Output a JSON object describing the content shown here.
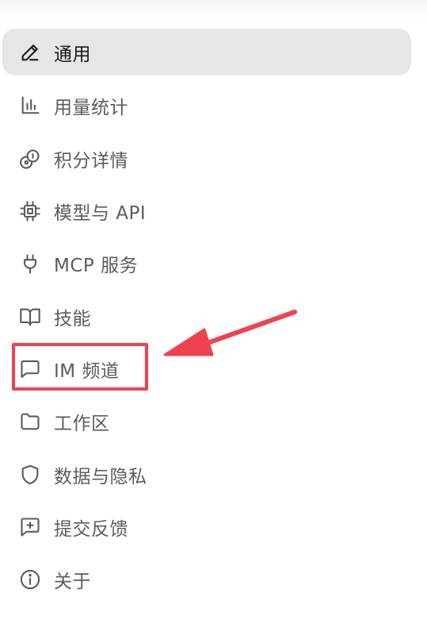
{
  "nav": {
    "items": [
      {
        "label": "通用",
        "icon": "pencil-icon",
        "active": true
      },
      {
        "label": "用量统计",
        "icon": "bar-chart-icon",
        "active": false
      },
      {
        "label": "积分详情",
        "icon": "coins-icon",
        "active": false
      },
      {
        "label": "模型与 API",
        "icon": "cpu-chip-icon",
        "active": false
      },
      {
        "label": "MCP 服务",
        "icon": "plug-icon",
        "active": false
      },
      {
        "label": "技能",
        "icon": "book-open-icon",
        "active": false
      },
      {
        "label": "IM 频道",
        "icon": "chat-bubble-icon",
        "active": false
      },
      {
        "label": "工作区",
        "icon": "folder-icon",
        "active": false
      },
      {
        "label": "数据与隐私",
        "icon": "shield-icon",
        "active": false
      },
      {
        "label": "提交反馈",
        "icon": "message-plus-icon",
        "active": false
      },
      {
        "label": "关于",
        "icon": "info-icon",
        "active": false
      }
    ]
  },
  "annotation": {
    "highlight_color": "#ef4250",
    "arrow_color": "#ef4250"
  }
}
